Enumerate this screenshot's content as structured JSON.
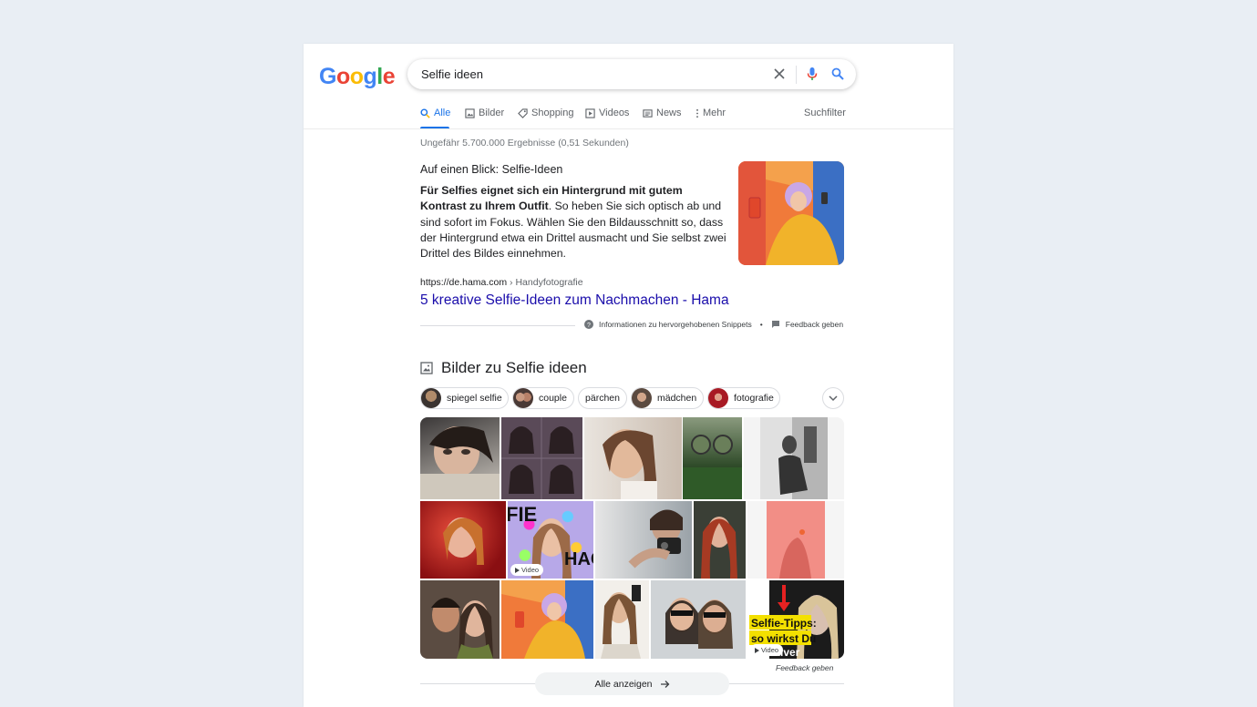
{
  "search": {
    "query": "Selfie ideen"
  },
  "tabs": [
    {
      "label": "Alle",
      "icon": "search-icon"
    },
    {
      "label": "Bilder",
      "icon": "image-icon"
    },
    {
      "label": "Shopping",
      "icon": "tag-icon"
    },
    {
      "label": "Videos",
      "icon": "play-icon"
    },
    {
      "label": "News",
      "icon": "news-icon"
    },
    {
      "label": "Mehr",
      "icon": "more-vert-icon"
    }
  ],
  "tools_label": "Suchfilter",
  "stats": "Ungefähr 5.700.000 Ergebnisse (0,51 Sekunden)",
  "snippet": {
    "title": "Auf einen Blick: Selfie-Ideen",
    "bold": "Für Selfies eignet sich ein Hintergrund mit gutem Kontrast zu Ihrem Outfit",
    "rest": ". So heben Sie sich optisch ab und sind sofort im Fokus. Wählen Sie den Bildausschnitt so, dass der Hintergrund etwa ein Drittel ausmacht und Sie selbst zwei Drittel des Bildes einnehmen.",
    "cite_domain": "https://de.hama.com",
    "cite_path": " › Handyfotografie",
    "link": "5 kreative Selfie-Ideen zum Nachmachen - Hama",
    "about": "Informationen zu hervorgehobenen Snippets",
    "dot": "•",
    "feedback": "Feedback geben"
  },
  "images": {
    "heading": "Bilder zu Selfie ideen",
    "chips": [
      "spiegel selfie",
      "couple",
      "pärchen",
      "mädchen",
      "fotografie"
    ],
    "video_label": "Video",
    "overlay_text_1": "FIE",
    "overlay_text_2": "HAC",
    "overlay_text_3": "Selfie-Tipps:",
    "overlay_text_4": "so wirkst Du",
    "overlay_text_5": "tiver",
    "feedback": "Feedback geben",
    "show_all": "Alle anzeigen"
  },
  "colors": {
    "link": "#1a0dab",
    "accent": "#1a73e8",
    "text": "#202124"
  }
}
